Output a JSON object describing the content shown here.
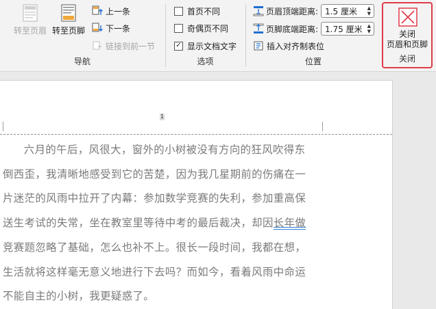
{
  "ribbon": {
    "navigation": {
      "label": "导航",
      "goto_header": "转至页眉",
      "goto_footer": "转至页脚",
      "previous": "上一条",
      "next": "下一条",
      "link_previous": "链接到前一节"
    },
    "options": {
      "label": "选项",
      "different_first_page": {
        "text": "首页不同",
        "checked": false
      },
      "different_odd_even": {
        "text": "奇偶页不同",
        "checked": false
      },
      "show_document_text": {
        "text": "显示文档文字",
        "checked": true
      },
      "check_mark": "✓"
    },
    "position": {
      "label": "位置",
      "header_from_top_label": "页眉顶端距离:",
      "header_from_top_value": "1.5 厘米",
      "footer_from_bottom_label": "页脚底端距离:",
      "footer_from_bottom_value": "1.75 厘米",
      "insert_alignment_tab": "插入对齐制表位"
    },
    "close": {
      "label": "关闭",
      "button_line1": "关闭",
      "button_line2": "页眉和页脚",
      "accent_color": "#e03a48"
    }
  },
  "document": {
    "page_number": "1",
    "paragraph_before": "六月的午后，风很大，窗外的小树被没有方向的狂风吹得东倒西歪，我清晰地感受到它的苦楚，因为我几星期前的伤痛在一片迷茫的风雨中拉开了内幕：参加数学竞赛的失利，参加重高保送生考试的失常，坐在教室里等待中考的最后裁决，却因",
    "paragraph_marked": "长年做",
    "paragraph_after": "竞赛题忽略了基础，怎么也补不上。很长一段时间，我都在想，生活就将这样毫无意义地进行下去吗？而如今，看着风雨中命运不能自主的小树，我更疑惑了。"
  }
}
